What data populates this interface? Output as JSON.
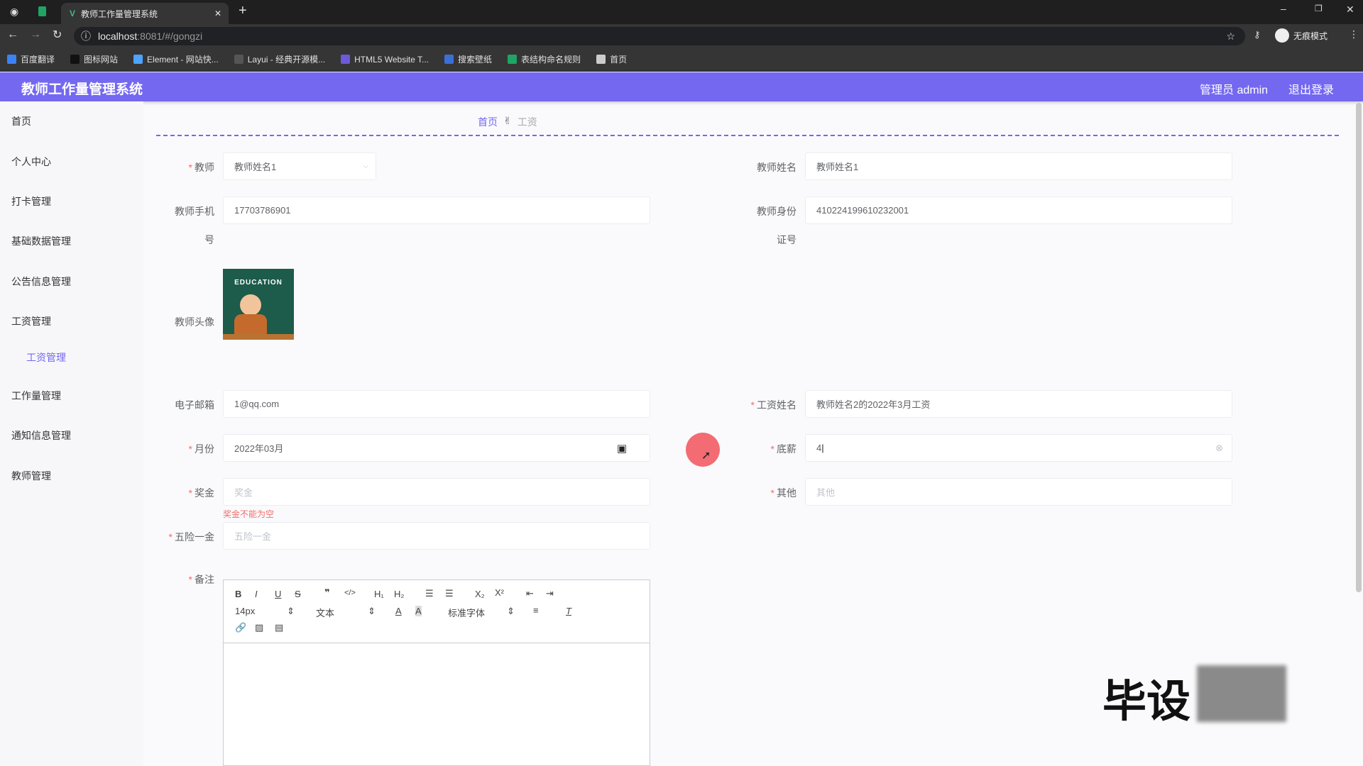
{
  "browser": {
    "tab_title": "教师工作量管理系统",
    "url_host": "localhost",
    "url_rest": ":8081/#/gongzi",
    "incognito": "无痕模式",
    "bookmarks": [
      {
        "label": "百度翻译",
        "color": "#3b82f6"
      },
      {
        "label": "图标网站",
        "color": "#111111"
      },
      {
        "label": "Element - 网站快...",
        "color": "#4da3ff"
      },
      {
        "label": "Layui - 经典开源模...",
        "color": "#555555"
      },
      {
        "label": "HTML5 Website T...",
        "color": "#6b5bd6"
      },
      {
        "label": "搜索壁纸",
        "color": "#3b6fd6"
      },
      {
        "label": "表结构命名规则",
        "color": "#1fa463"
      },
      {
        "label": "首页",
        "color": "#cccccc"
      }
    ]
  },
  "header": {
    "title": "教师工作量管理系统",
    "user": "管理员 admin",
    "logout": "退出登录",
    "color": "#7468f0"
  },
  "sidebar": {
    "items": [
      "首页",
      "个人中心",
      "打卡管理",
      "基础数据管理",
      "公告信息管理",
      "工资管理",
      "工作量管理",
      "通知信息管理",
      "教师管理"
    ],
    "sub_item": "工资管理"
  },
  "breadcrumb": {
    "home": "首页",
    "current": "工资"
  },
  "form": {
    "teacher": {
      "label": "教师",
      "value": "教师姓名1"
    },
    "teacher_name": {
      "label": "教师姓名",
      "value": "教师姓名1"
    },
    "phone": {
      "label1": "教师手机",
      "label2": "号",
      "value": "17703786901"
    },
    "id_card": {
      "label1": "教师身份",
      "label2": "证号",
      "value": "410224199610232001"
    },
    "avatar": {
      "label": "教师头像",
      "art_text": "EDUCATION"
    },
    "email": {
      "label": "电子邮箱",
      "value": "1@qq.com"
    },
    "salary_name": {
      "label": "工资姓名",
      "value": "教师姓名2的2022年3月工资"
    },
    "month": {
      "label": "月份",
      "value": "2022年03月"
    },
    "base_salary": {
      "label": "底薪",
      "value": "4"
    },
    "bonus": {
      "label": "奖金",
      "placeholder": "奖金",
      "error": "奖金不能为空"
    },
    "other": {
      "label": "其他",
      "placeholder": "其他"
    },
    "insurance": {
      "label": "五险一金",
      "placeholder": "五险一金"
    },
    "remark": {
      "label": "备注",
      "font_size": "14px",
      "text_type": "文本",
      "font_family": "标准字体"
    }
  },
  "watermark": "毕设"
}
